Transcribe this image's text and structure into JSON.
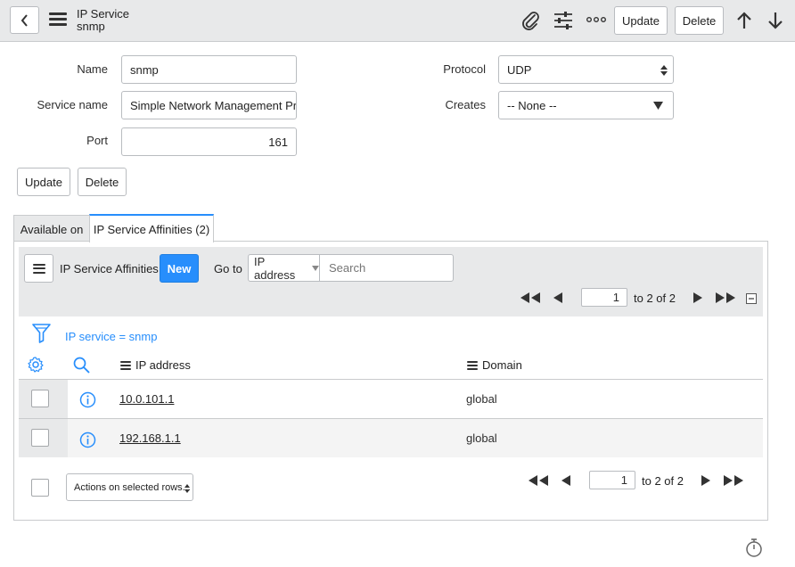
{
  "header": {
    "title_line1": "IP Service",
    "title_line2": "snmp",
    "update_label": "Update",
    "delete_label": "Delete"
  },
  "form": {
    "name_label": "Name",
    "name_value": "snmp",
    "service_name_label": "Service name",
    "service_name_value": "Simple Network Management Pro",
    "port_label": "Port",
    "port_value": "161",
    "protocol_label": "Protocol",
    "protocol_value": "UDP",
    "creates_label": "Creates",
    "creates_value": "-- None --",
    "update_label": "Update",
    "delete_label": "Delete"
  },
  "tabs": [
    {
      "label": "Available on",
      "active": false
    },
    {
      "label": "IP Service Affinities (2)",
      "active": true
    }
  ],
  "list": {
    "title": "IP Service Affinities",
    "new_label": "New",
    "goto_label": "Go to",
    "goto_field": "IP address",
    "search_placeholder": "Search",
    "page_value": "1",
    "page_of": "to 2 of 2",
    "filter_text": "IP service = snmp",
    "columns": [
      "IP address",
      "Domain"
    ],
    "rows": [
      {
        "ip": "10.0.101.1",
        "domain": "global"
      },
      {
        "ip": "192.168.1.1",
        "domain": "global"
      }
    ],
    "actions_label": "Actions on selected rows...",
    "footer_page_value": "1",
    "footer_page_of": "to 2 of 2"
  },
  "colors": {
    "accent": "#278efc",
    "header_bg": "#e8e9ea"
  }
}
